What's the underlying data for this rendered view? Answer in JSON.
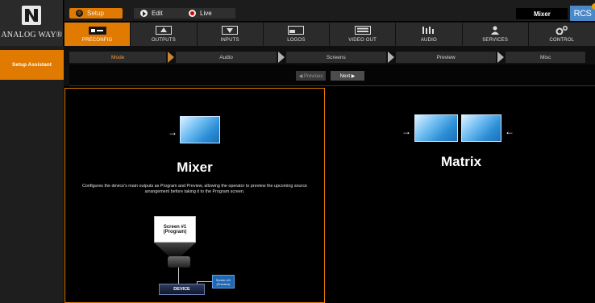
{
  "brand": {
    "name": "ANALOG WAY®",
    "logo_icon": "analog-way-logo"
  },
  "modes": [
    {
      "label": "Setup",
      "icon": "gear-icon"
    },
    {
      "label": "Edit",
      "icon": "play-icon"
    },
    {
      "label": "Live",
      "icon": "record-icon"
    }
  ],
  "status": {
    "mode_badge": "Mixer",
    "rcs_badge": "RCS"
  },
  "tabs": [
    {
      "label": "PRECONFIG",
      "icon": "preconfig-icon"
    },
    {
      "label": "OUTPUTS",
      "icon": "outputs-icon"
    },
    {
      "label": "INPUTS",
      "icon": "inputs-icon"
    },
    {
      "label": "LOGOS",
      "icon": "logos-icon"
    },
    {
      "label": "VIDEO OUT",
      "icon": "video-out-icon"
    },
    {
      "label": "AUDIO",
      "icon": "audio-icon"
    },
    {
      "label": "SERVICES",
      "icon": "services-icon"
    },
    {
      "label": "CONTROL",
      "icon": "control-icon"
    }
  ],
  "sidebar": {
    "items": [
      {
        "label": "Setup Assistant"
      }
    ]
  },
  "wizard": {
    "steps": [
      {
        "label": "Mode"
      },
      {
        "label": "Audio"
      },
      {
        "label": "Screens"
      },
      {
        "label": "Preview"
      },
      {
        "label": "Misc"
      }
    ],
    "prev_label": "◀ Previous",
    "next_label": "Next ▶"
  },
  "panels": {
    "mixer": {
      "title": "Mixer",
      "description": "Configures the device's main outputs as Program and Preview, allowing the operator to preview the upcoming source arrangement before taking it to the Program screen.",
      "diagram": {
        "program_line1": "Screen #1",
        "program_line2": "(Program)",
        "device_label": "DEVICE",
        "preview_line1": "Screen #1",
        "preview_line2": "(Preview)"
      }
    },
    "matrix": {
      "title": "Matrix"
    }
  },
  "colors": {
    "accent": "#e07a00",
    "screen_blue": "#2d8fd6",
    "rcs_blue": "#4a88c8"
  }
}
